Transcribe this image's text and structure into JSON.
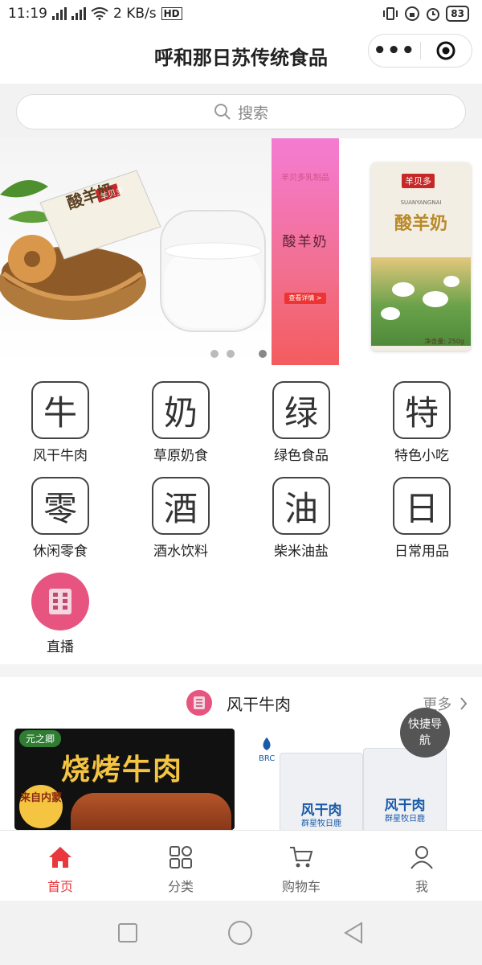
{
  "status_bar": {
    "time": "11:19",
    "net_speed": "2 KB/s",
    "battery": "83",
    "network_1": "4G",
    "network_2": "2G"
  },
  "nav": {
    "title": "呼和那日苏传统食品",
    "more_icon": "more-dots-icon",
    "close_icon": "target-icon"
  },
  "search": {
    "placeholder": "搜索"
  },
  "banner": {
    "promo_small": "羊贝多乳制品",
    "promo_title": "酸羊奶",
    "promo_button": "查看详情 >",
    "pack_brand": "羊贝多",
    "pack_sub": "SUANYANGNAI",
    "pack_title": "酸羊奶",
    "pack_weight": "净含量: 250g",
    "left_pack_title": "酸羊奶",
    "left_pack_brand": "羊贝多",
    "slides": 4,
    "active_slide": 4
  },
  "categories": [
    {
      "glyph": "牛",
      "label": "风干牛肉"
    },
    {
      "glyph": "奶",
      "label": "草原奶食"
    },
    {
      "glyph": "绿",
      "label": "绿色食品"
    },
    {
      "glyph": "特",
      "label": "特色小吃"
    },
    {
      "glyph": "零",
      "label": "休闲零食"
    },
    {
      "glyph": "酒",
      "label": "酒水饮料"
    },
    {
      "glyph": "油",
      "label": "柴米油盐"
    },
    {
      "glyph": "日",
      "label": "日常用品"
    },
    {
      "glyph": "",
      "label": "直播"
    }
  ],
  "section": {
    "title": "风干牛肉",
    "more": "更多",
    "icon": "section-book-icon"
  },
  "products": {
    "left_badge": "元之卿",
    "left_title": "烧烤牛肉",
    "left_circle": "来自内蒙",
    "right_brand": "BRC",
    "bag_title": "风干肉",
    "bag_sub": "群星牧日鹿"
  },
  "quick_nav": {
    "label": "快捷导航"
  },
  "tabs": [
    {
      "label": "首页",
      "icon": "home-icon",
      "active": true
    },
    {
      "label": "分类",
      "icon": "grid-icon",
      "active": false
    },
    {
      "label": "购物车",
      "icon": "cart-icon",
      "active": false
    },
    {
      "label": "我",
      "icon": "user-icon",
      "active": false
    }
  ],
  "colors": {
    "accent": "#e8383d",
    "pink": "#e75480"
  }
}
